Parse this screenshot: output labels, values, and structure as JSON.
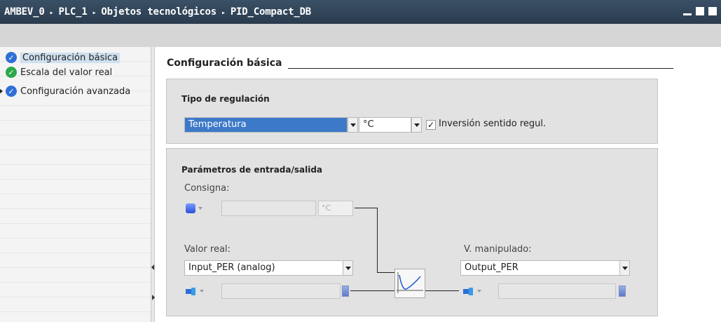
{
  "titlebar": {
    "crumbs": [
      "AMBEV_0",
      "PLC_1",
      "Objetos tecnológicos",
      "PID_Compact_DB"
    ],
    "separator": "▸"
  },
  "nav": {
    "items": [
      {
        "label": "Configuración básica",
        "status": "blue-check",
        "selected": true
      },
      {
        "label": "Escala del valor real",
        "status": "green-check",
        "selected": false
      },
      {
        "label": "Configuración avanzada",
        "status": "blue-check",
        "selected": false,
        "expandable": true
      }
    ]
  },
  "main": {
    "section_title": "Configuración básica",
    "regulation": {
      "title": "Tipo de regulación",
      "type_value": "Temperatura",
      "unit_value": "°C",
      "invert_label": "Inversión sentido regul.",
      "invert_checked": "✓"
    },
    "io": {
      "title": "Parámetros de entrada/salida",
      "setpoint_label": "Consigna:",
      "setpoint_unit": "°C",
      "input_label": "Valor real:",
      "input_value": "Input_PER (analog)",
      "output_label": "V. manipulado:",
      "output_value": "Output_PER"
    }
  },
  "colors": {
    "titlebar": "#2f4257",
    "selection": "#3c79c9",
    "panel": "#e2e2e2"
  }
}
